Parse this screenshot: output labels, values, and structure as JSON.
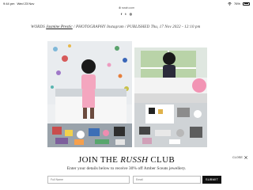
{
  "status_bar": {
    "time": "9:44 pm",
    "date": "Wed 23 Nov",
    "battery": "76%",
    "battery_level": 0.76
  },
  "browser": {
    "url": "russh.com"
  },
  "social": {
    "icons": [
      "facebook-icon",
      "twitter-icon",
      "instagram-icon"
    ],
    "glyphs": [
      "f",
      "t",
      "◎"
    ]
  },
  "article": {
    "words_label": "WORDS",
    "author": "Jasmine Prestic",
    "photography_label": "PHOTOGRAPHY",
    "photographer": "Instagram",
    "published_label": "PUBLISHED",
    "published_date": "Thu, 17 Nov 2022 - 12:10 pm"
  },
  "newsletter": {
    "title_prefix": "JOIN THE",
    "title_brand": "RUSSH",
    "title_suffix": "CLUB",
    "subtitle": "Enter your details below to receive 30% off Amber Sceats jewellery.",
    "close_label": "CLOSE",
    "name_placeholder": "Full Name",
    "email_placeholder": "Email",
    "submit_label": "SUBMIT"
  }
}
